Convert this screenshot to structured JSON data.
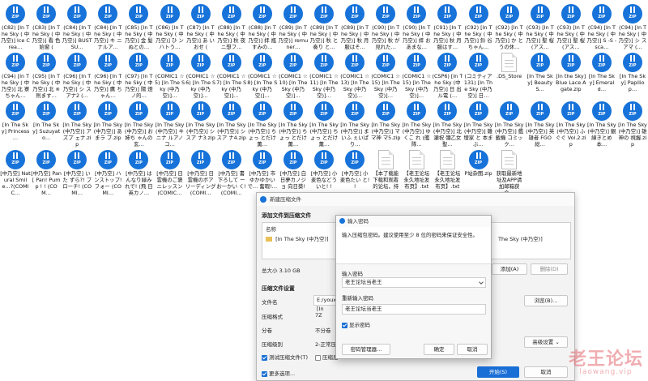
{
  "desktop": {
    "files": [
      {
        "type": "zip",
        "label": "(C82) [In The Sky ( 中乃空)] Ice Crea…"
      },
      {
        "type": "zip",
        "label": "(C83) [In The Sky ( 中乃空)] 看 色始窗 ("
      },
      {
        "type": "zip",
        "label": "(C84) [In The Sky ( 中乃空)] BUST SU…"
      },
      {
        "type": "zip",
        "label": "(C84) [In The Sky ( 中乃空)] キ ニナルア…"
      },
      {
        "type": "zip",
        "label": "(C85) [In The Sky ( 中乃空)] 金 髪ぬとの…"
      },
      {
        "type": "zip",
        "label": "(C86) [In The Sky ( 中乃空)] ひ ンハトう…"
      },
      {
        "type": "zip",
        "label": "(C87) [In The Sky ( 中乃空)] あ いおせ ("
      },
      {
        "type": "zip",
        "label": "(C88) [In The Sky ( 中乃空)] 秋 夜ニ想フ…"
      },
      {
        "type": "zip",
        "label": "(C88) [In The Sky ( 中乃空)] 拝 瓶すみの…"
      },
      {
        "type": "zip",
        "label": "(C89) [In The Sky ( 中乃空)] remuner…"
      },
      {
        "type": "zip",
        "label": "(C89) [In The Sky ( 中乃空)] 秋 と 奏り と…"
      },
      {
        "type": "zip",
        "label": "(C89) [In The Sky ( 中乃空)] 秋 月服はそ…"
      },
      {
        "type": "zip",
        "label": "(C90) [In The Sky ( 中乃空)] 秋 が見れた…"
      },
      {
        "type": "zip",
        "label": "(C90) [In The Sky ( 中乃空)] 拝 おあまな…"
      },
      {
        "type": "zip",
        "label": "(C91) [In The Sky ( 中乃空)] 秋 月服はす…"
      },
      {
        "type": "zip",
        "label": "(C92) [In The Sky ( 中乃空)] 鈴 谷ちゃん…"
      },
      {
        "type": "zip",
        "label": "(C92) [In The Sky ( 中乃空)] か とうの休…"
      },
      {
        "type": "zip",
        "label": "(C93) [In The Sky ( 中乃空)] 聖 桜 (アス…"
      },
      {
        "type": "zip",
        "label": "(C93) [In The Sky ( 中乃空)] 聖 桜 (アス…"
      },
      {
        "type": "zip",
        "label": "(C94) [In The Sky ( 中乃空)] S -S -sca…"
      },
      {
        "type": "zip",
        "label": "(C94) [In The Sky ( 中乃空)] シ スアマ (…"
      },
      {
        "type": "zip",
        "label": "(C94) [In The Sky ( 中乃空)] 北 寮ちゃん…"
      },
      {
        "type": "zip",
        "label": "(C95) [In The Sky ( 中乃空)] 北 ※則ます…"
      },
      {
        "type": "zip",
        "label": "(C96) [In The Sky ( 中乃空)] シ スアナ2 (…"
      },
      {
        "type": "zip",
        "label": "(C96) [In The Sky ( 中乃空)] 鷹 ちゃん…"
      },
      {
        "type": "zip",
        "label": "(C97) [In The Sky ( 中乃空)] 陽 燈ノ的…"
      },
      {
        "type": "zip",
        "label": "(COMIC1 ☆5) [In The Sky (中乃空)]…"
      },
      {
        "type": "zip",
        "label": "(COMIC1 ☆6) [In The Sky (中乃空)]…"
      },
      {
        "type": "zip",
        "label": "(COMIC1 ☆7) [In The Sky (中乃空)]…"
      },
      {
        "type": "zip",
        "label": "(COMIC1 ☆8) [In The Sky (中乃空)]…"
      },
      {
        "type": "zip",
        "label": "(COMIC1 ☆10) [In The Sky (中乃空)]…"
      },
      {
        "type": "zip",
        "label": "(COMIC1 ☆11) [In The Sky (中乃空)]…"
      },
      {
        "type": "zip",
        "label": "(COMIC1 ☆13) [In The Sky (中乃空)]…"
      },
      {
        "type": "zip",
        "label": "(COMIC1 ☆15) [In The Sky (中乃空)]…"
      },
      {
        "type": "zip",
        "label": "(COMIC1 ☆15) [In The Sky (中乃空)]…"
      },
      {
        "type": "zip",
        "label": "(CSP6) [In The Sky (中乃空)] 日 出ル電 (…"
      },
      {
        "type": "zip",
        "label": "(コミティア131) [In The Sky (中乃空)] 日…"
      },
      {
        "type": "doc",
        "label": ".DS_Store"
      },
      {
        "type": "zip",
        "label": "[In The Sky] Beauty S…"
      },
      {
        "type": "zip",
        "label": "[In the Sky] Blue Lace Agate.zip"
      },
      {
        "type": "zip",
        "label": "[In The Sky] Emerald…"
      },
      {
        "type": "zip",
        "label": "[In The Sky] Papilio p…"
      },
      {
        "type": "zip",
        "label": "[In The Sky] Princess …"
      },
      {
        "type": "zip",
        "label": "[In The Sky] Suzuyato…"
      },
      {
        "type": "zip",
        "label": "[In The Sky (中乃空)] アズプ ェナ.zip"
      },
      {
        "type": "zip",
        "label": "[In The Sky (中乃空)] あまラ ブ.zip"
      },
      {
        "type": "zip",
        "label": "[In The Sky (中乃空)] お姉ち ゃんの玄…"
      },
      {
        "type": "zip",
        "label": "[In The Sky (中乃空)] キニナ ルアノコ…"
      },
      {
        "type": "zip",
        "label": "[In The Sky (中乃空)] シスア ナ3.zip"
      },
      {
        "type": "zip",
        "label": "[In The Sky (中乃空)] シスア ナ4.zip"
      },
      {
        "type": "zip",
        "label": "[In The Sky (中乃空)] ちょっ とだけ薫…"
      },
      {
        "type": "zip",
        "label": "[In The Sky (中乃空)] ちょっ とだけ薫…"
      },
      {
        "type": "zip",
        "label": "[In The Sky (中乃空)] ちょっ とだけ薫…"
      },
      {
        "type": "zip",
        "label": "[In The Sky (中乃空)] まいふ ぇいぱり…"
      },
      {
        "type": "zip",
        "label": "[In The Sky (中乃空)] ママ神 マ5.zip"
      },
      {
        "type": "zip",
        "label": "[In The Sky (中乃空)] ゆくこ れ (艦隊…"
      },
      {
        "type": "zip",
        "label": "[In The Sky (中乃空)] 北瀬祝 彌乙女聖…"
      },
      {
        "type": "zip",
        "label": "[In The Sky (中乃空)] 雛壇家 と 本まぶ…"
      },
      {
        "type": "zip",
        "label": "[In The Sky (中乃空)] 艦載機 コミック…"
      },
      {
        "type": "zip",
        "label": "[In The Sky (中乃空)] 英雄者 FGO総…"
      },
      {
        "type": "zip",
        "label": "[In The Sky (中乃空)] ふぐぐ Vol.2.zip"
      },
      {
        "type": "zip",
        "label": "[In The Sky (中乃空)] 観練きとめ 本…"
      },
      {
        "type": "zip",
        "label": "[In The Sky (中乃空)] 雄神の 視握.zip"
      },
      {
        "type": "zip",
        "label": "[中乃空] Natural Smile…?(COMIC…"
      },
      {
        "type": "zip",
        "label": "[中乃空] Pan[ Pan! Pump ! ! (COM…"
      },
      {
        "type": "zip",
        "label": "[中乃空] いた ずら?! プ ローチ! (COMI…"
      },
      {
        "type": "zip",
        "label": "[中乃空] ハ ンストップ! フォー (COMI…"
      },
      {
        "type": "zip",
        "label": "[中乃空] は んなり緑み れで! (飛 日英カノ…"
      },
      {
        "type": "zip",
        "label": "[中乃空] 日 雲機のご褒 ニレッスン (COMIC…"
      },
      {
        "type": "zip",
        "label": "[中乃空] 日 雲機のボア リーディング (COMI…"
      },
      {
        "type": "zip",
        "label": "[中乃空] 書 下ろして ーおーかい く! (COMI…"
      },
      {
        "type": "zip",
        "label": "[中乃空] 市 ゆかゆかいで… 奮暇!…"
      },
      {
        "type": "zip",
        "label": "[中乃空] 白 日夢カノジョ 向日葵!"
      },
      {
        "type": "zip",
        "label": "[中乃空] 小 麦色などう いと! !"
      },
      {
        "type": "zip",
        "label": "[中乃空] 小 麦色たい と! !"
      },
      {
        "type": "doc",
        "label": "【本了载能 下载和观看 的论坛，持"
      },
      {
        "type": "doc",
        "label": "【老王论坛 永久地址发 布页】.txt"
      },
      {
        "type": "doc",
        "label": "【老王论坛 永久地址发 布页】.txt"
      },
      {
        "type": "zip",
        "label": "P站杂图.zip"
      },
      {
        "type": "doc",
        "label": "获取最新地 址及APP请 加邮箱获合…"
      }
    ]
  },
  "compress_window": {
    "title": "新建压缩文件",
    "section_files": "添加文件到压缩文件",
    "col_name": "名称",
    "file_row": "[In The Sky (中乃空)]",
    "file_row_tail": "The Sky (中乃空)]",
    "total_size": "总大小 3.10 GB",
    "btn_add": "添加(A)",
    "btn_add_folder": "添加文件夹",
    "btn_delete": "删除(D)",
    "section_settings": "压缩文件设置",
    "file_name_label": "文件名",
    "file_name_value": "E:/youxi\\[In",
    "format_label": "压缩格式",
    "format_value": "7Z",
    "volume_label": "分卷",
    "volume_value": "不分卷",
    "level_label": "压缩级别",
    "level_value": "2-正常压缩",
    "browse_button": "浏览(B)...",
    "test_checkbox": "测试压缩文件(T)",
    "after_checkbox": "压缩后…",
    "advanced_button": "高级设置",
    "more_options": "更多选项...",
    "start_button": "开始(S)",
    "cancel_button": "取消"
  },
  "password_dialog": {
    "title": "输入密码",
    "hint": "输入压缩包密码。建议使用至少 8 位的密码来保证安全性。",
    "password_label": "输入密码",
    "password_value": "老王论坛当老王",
    "confirm_label": "重新输入密码",
    "confirm_value": "老王论坛当老王",
    "show_password": "显示密码",
    "manager_button": "密码管理器...",
    "ok_button": "确定",
    "cancel_button": "取消"
  },
  "watermark": {
    "line1": "老王论坛",
    "line2": "laowang.vip"
  },
  "colors": {
    "zip_icon": "#1773d9",
    "primary_button": "#1a6fd6",
    "watermark": "#e46b72"
  }
}
